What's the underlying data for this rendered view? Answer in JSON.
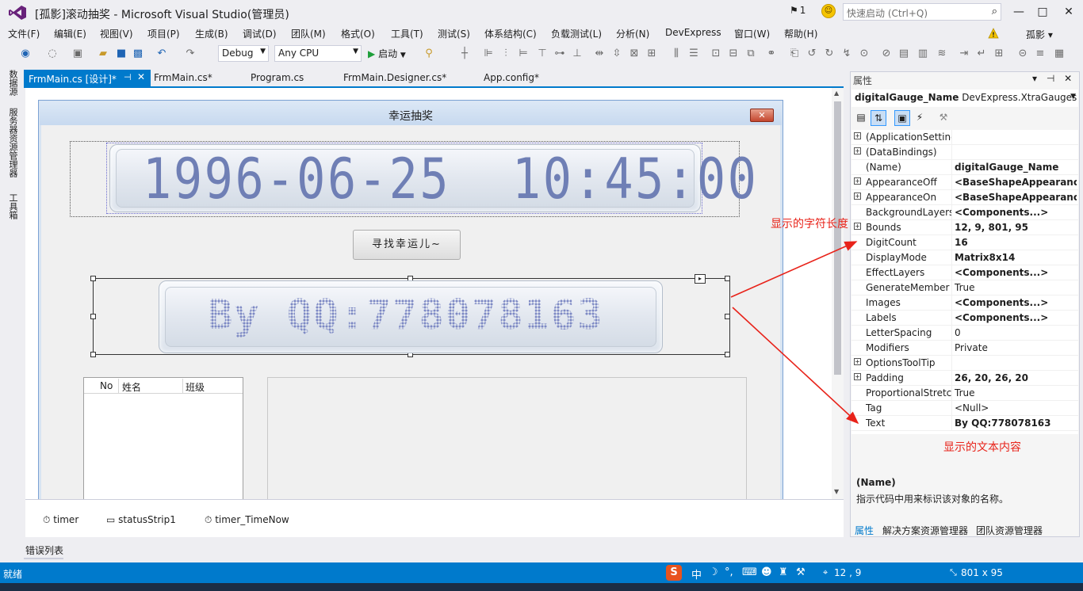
{
  "window": {
    "title": "[孤影]滚动抽奖 - Microsoft Visual Studio(管理员)",
    "notification_count": "1",
    "quick_launch_placeholder": "快速启动 (Ctrl+Q)",
    "min": "—",
    "max": "□",
    "close": "✕"
  },
  "menu": {
    "items": [
      "文件(F)",
      "编辑(E)",
      "视图(V)",
      "项目(P)",
      "生成(B)",
      "调试(D)",
      "团队(M)",
      "格式(O)",
      "工具(T)",
      "测试(S)",
      "体系结构(C)",
      "负载测试(L)",
      "分析(N)",
      "DevExpress",
      "窗口(W)",
      "帮助(H)"
    ],
    "user": "孤影 ▾"
  },
  "toolbar": {
    "config": "Debug",
    "platform": "Any CPU",
    "start": "启动"
  },
  "side_tabs": [
    "数据源",
    "服务器资源管理器",
    "工具箱"
  ],
  "doc_tabs": [
    {
      "label": "FrmMain.cs [设计]*"
    },
    {
      "label": "FrmMain.cs*"
    },
    {
      "label": "Program.cs"
    },
    {
      "label": "FrmMain.Designer.cs*"
    },
    {
      "label": "App.config*"
    }
  ],
  "form": {
    "title": "幸运抽奖",
    "close": "✕",
    "gauge_datetime": "1996-06-25  10:45:00",
    "lucky_button": "寻找幸运儿~",
    "gauge_name_text": "By QQ:778078163",
    "smart_tag": "▸",
    "list_headers": [
      "No",
      "姓名",
      "班级"
    ]
  },
  "tray": [
    {
      "icon": "⏱",
      "label": "timer"
    },
    {
      "icon": "▭",
      "label": "statusStrip1"
    },
    {
      "icon": "⏱",
      "label": "timer_TimeNow"
    }
  ],
  "error_list": "错误列表",
  "properties": {
    "title": "属性",
    "head_btns": "▾ ⊣ ✕",
    "object_name": "digitalGauge_Name",
    "object_type": "DevExpress.XtraGauges",
    "rows": [
      {
        "expand": "+",
        "name": "(ApplicationSetting",
        "value": "",
        "bold": false
      },
      {
        "expand": "+",
        "name": "(DataBindings)",
        "value": "",
        "bold": false
      },
      {
        "expand": "",
        "name": "(Name)",
        "value": "digitalGauge_Name",
        "bold": true
      },
      {
        "expand": "+",
        "name": "AppearanceOff",
        "value": "<BaseShapeAppearance>",
        "bold": true
      },
      {
        "expand": "+",
        "name": "AppearanceOn",
        "value": "<BaseShapeAppearance>",
        "bold": true
      },
      {
        "expand": "",
        "name": "BackgroundLayers",
        "value": "<Components...>",
        "bold": true
      },
      {
        "expand": "+",
        "name": "Bounds",
        "value": "12, 9, 801, 95",
        "bold": true
      },
      {
        "expand": "",
        "name": "DigitCount",
        "value": "16",
        "bold": true
      },
      {
        "expand": "",
        "name": "DisplayMode",
        "value": "Matrix8x14",
        "bold": true
      },
      {
        "expand": "",
        "name": "EffectLayers",
        "value": "<Components...>",
        "bold": true
      },
      {
        "expand": "",
        "name": "GenerateMember",
        "value": "True",
        "bold": false
      },
      {
        "expand": "",
        "name": "Images",
        "value": "<Components...>",
        "bold": true
      },
      {
        "expand": "",
        "name": "Labels",
        "value": "<Components...>",
        "bold": true
      },
      {
        "expand": "",
        "name": "LetterSpacing",
        "value": "0",
        "bold": false
      },
      {
        "expand": "",
        "name": "Modifiers",
        "value": "Private",
        "bold": false
      },
      {
        "expand": "+",
        "name": "OptionsToolTip",
        "value": "",
        "bold": false
      },
      {
        "expand": "+",
        "name": "Padding",
        "value": "26, 20, 26, 20",
        "bold": true
      },
      {
        "expand": "",
        "name": "ProportionalStretc",
        "value": "True",
        "bold": false
      },
      {
        "expand": "",
        "name": "Tag",
        "value": "<Null>",
        "bold": false
      },
      {
        "expand": "",
        "name": "Text",
        "value": "By QQ:778078163",
        "bold": true
      }
    ],
    "desc_name": "(Name)",
    "desc_text": "指示代码中用来标识该对象的名称。",
    "tabs": [
      "属性",
      "解决方案资源管理器",
      "团队资源管理器"
    ]
  },
  "annotations": {
    "digit_count": "显示的字符长度",
    "text": "显示的文本内容"
  },
  "status": {
    "text": "就绪",
    "ime_logo": "S",
    "ime_lang": "中",
    "position": "12 , 9",
    "size": "801 x 95"
  },
  "colors": {
    "accent": "#007ACC",
    "annotation": "#E8231A",
    "gauge_digits": "#6F7FB5"
  }
}
